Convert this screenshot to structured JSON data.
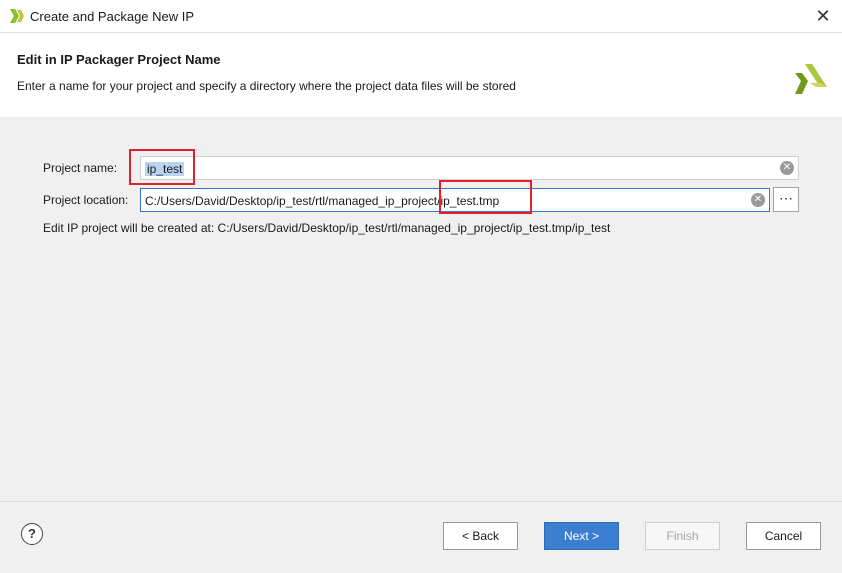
{
  "window": {
    "title": "Create and Package New IP",
    "close_icon": "close-icon"
  },
  "header": {
    "title": "Edit in IP Packager Project Name",
    "description": "Enter a name for your project and specify a directory where the project data files will be stored"
  },
  "form": {
    "project_name": {
      "label": "Project name:",
      "value": "ip_test"
    },
    "project_location": {
      "label": "Project location:",
      "value": "C:/Users/David/Desktop/ip_test/rtl/managed_ip_project/ip_test.tmp",
      "browse_label": "⋯"
    },
    "info": "Edit IP project will be created at: C:/Users/David/Desktop/ip_test/rtl/managed_ip_project/ip_test.tmp/ip_test"
  },
  "footer": {
    "help_label": "?",
    "back_label": "< Back",
    "next_label": "Next >",
    "finish_label": "Finish",
    "cancel_label": "Cancel"
  },
  "colors": {
    "accent": "#3c7fd1",
    "highlight": "#e0202a",
    "logo_green": "#8cbf26"
  }
}
